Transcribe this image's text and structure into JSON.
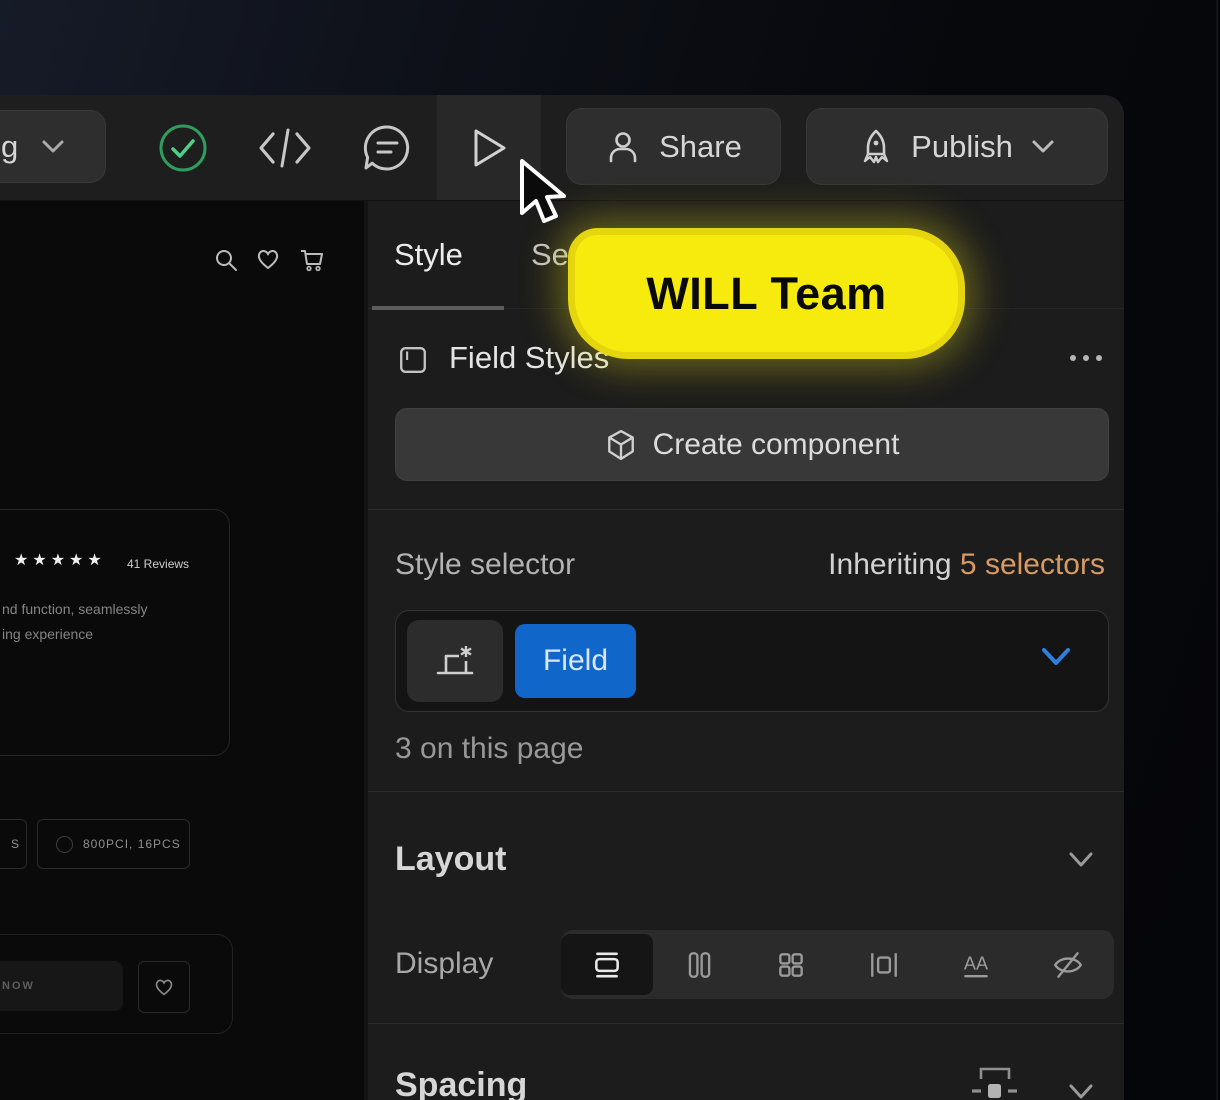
{
  "toolbar": {
    "workspace_button_label": "g",
    "share_label": "Share",
    "publish_label": "Publish"
  },
  "cursor_label": {
    "text": "WILL Team"
  },
  "panel": {
    "tabs": [
      {
        "label": "Style"
      },
      {
        "label": "Se"
      }
    ],
    "field_styles": {
      "label": "Field Styles"
    },
    "create_component_label": "Create component",
    "style_selector": {
      "label": "Style selector",
      "inheriting_label": "Inheriting ",
      "inheriting_count": "5 selectors",
      "tag": "Field",
      "usage": "3 on this page"
    },
    "layout": {
      "title": "Layout",
      "display_label": "Display",
      "display_options": [
        "block",
        "flex",
        "grid",
        "inline-block",
        "inline",
        "none"
      ],
      "active_display": "block",
      "inline_icon_text": "AA"
    },
    "spacing": {
      "title": "Spacing"
    }
  },
  "canvas": {
    "stars": "★★★★★",
    "reviews": "41 Reviews",
    "description_line1": "nd function, seamlessly",
    "description_line2": "ing experience",
    "option_partial": "S",
    "option_label": "800PCI, 16PCS",
    "buy_label": "NOW"
  },
  "colors": {
    "accent_blue": "#1166ca",
    "selector_orange": "#d79a62",
    "cursor_yellow": "#f7eb0e",
    "success_green": "#3fcf8a"
  }
}
